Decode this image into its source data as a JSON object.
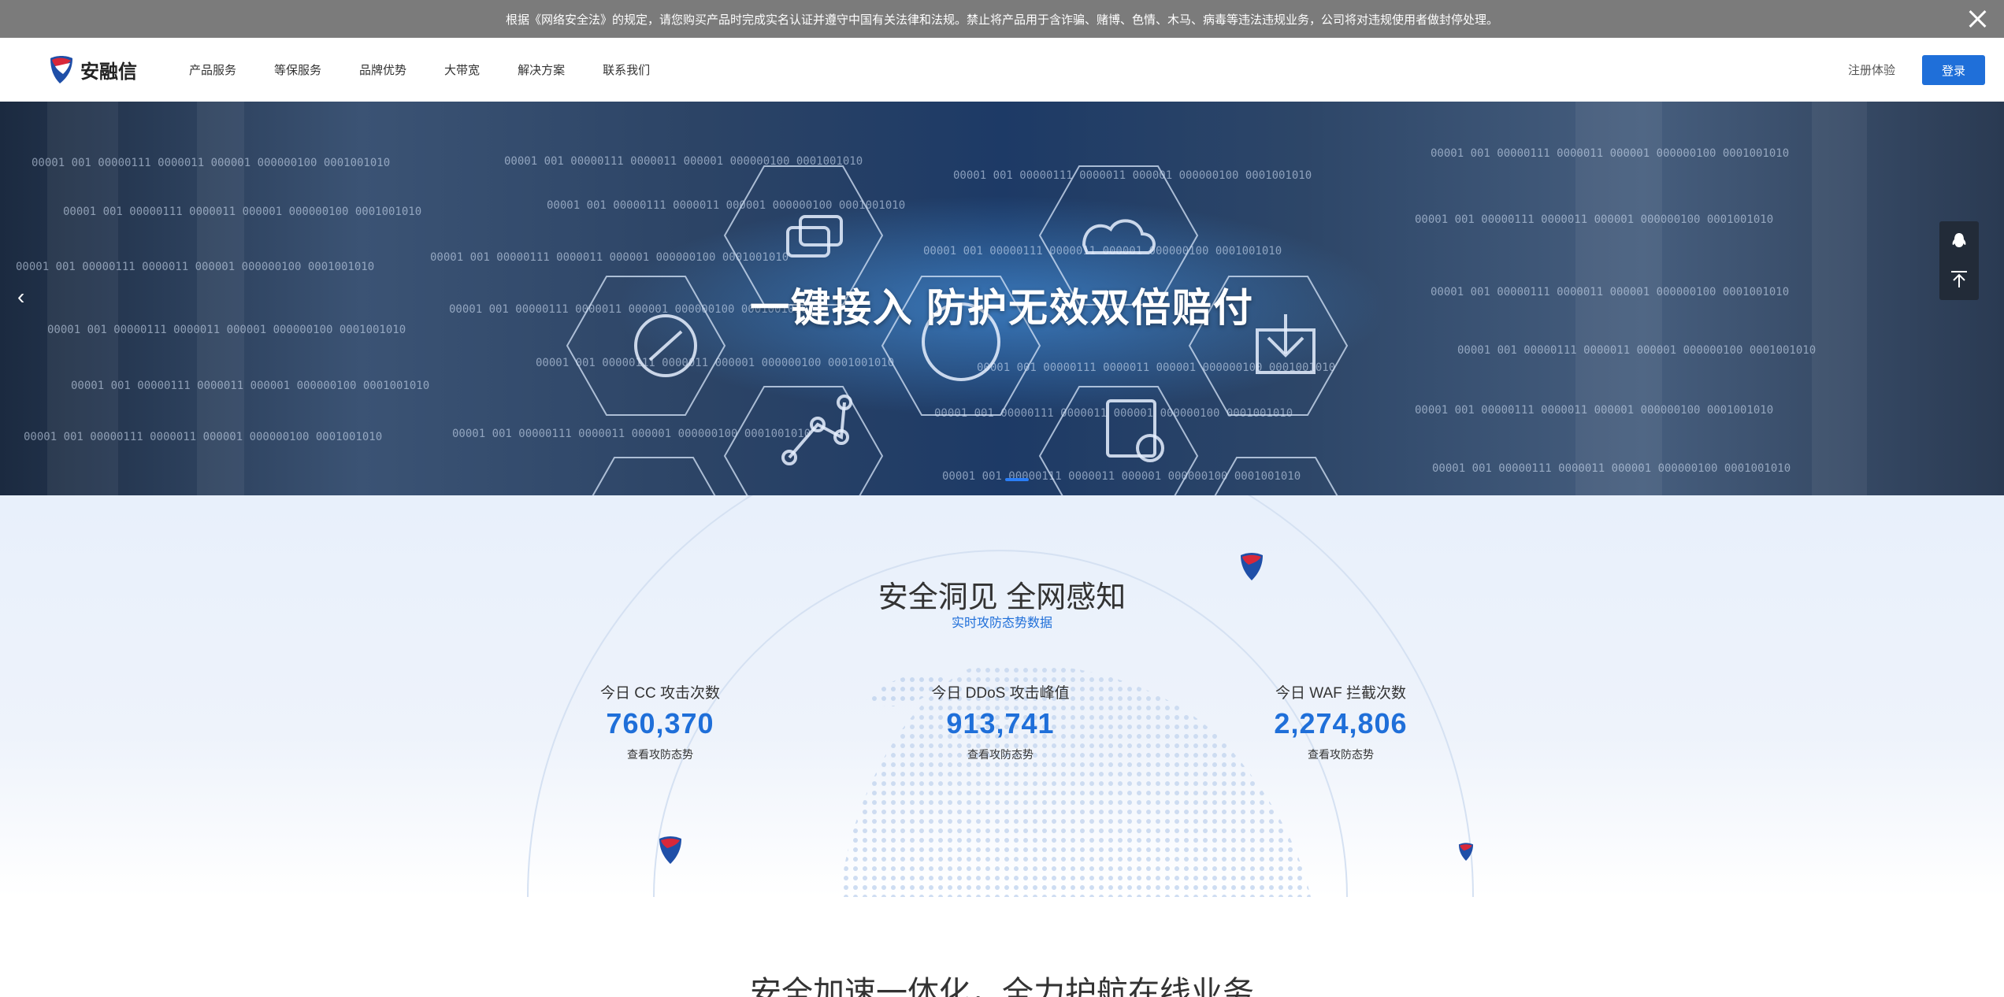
{
  "notice": {
    "text": "根据《网络安全法》的规定，请您购买产品时完成实名认证并遵守中国有关法律和法规。禁止将产品用于含诈骗、赌博、色情、木马、病毒等违法违规业务，公司将对违规使用者做封停处理。"
  },
  "nav": {
    "brand": "安融信",
    "menu": [
      "产品服务",
      "等保服务",
      "品牌优势",
      "大带宽",
      "解决方案",
      "联系我们"
    ],
    "register": "注册体验",
    "login": "登录"
  },
  "hero": {
    "title": "一键接入 防护无效双倍赔付",
    "code_text": "00001 001  00000111 0000011   000001  000000100 0001001010"
  },
  "stats": {
    "title": "安全洞见 全网感知",
    "subtitle": "实时攻防态势数据",
    "items": [
      {
        "label": "今日 CC 攻击次数",
        "value": "760,370",
        "link": "查看攻防态势"
      },
      {
        "label": "今日 DDoS 攻击峰值",
        "value": "913,741",
        "link": "查看攻防态势"
      },
      {
        "label": "今日 WAF 拦截次数",
        "value": "2,274,806",
        "link": "查看攻防态势"
      }
    ]
  },
  "section2": {
    "title": "安全加速一体化，全力护航在线业务"
  },
  "colors": {
    "accent": "#1f6fd9",
    "notice_bg": "#7b7b7b"
  }
}
